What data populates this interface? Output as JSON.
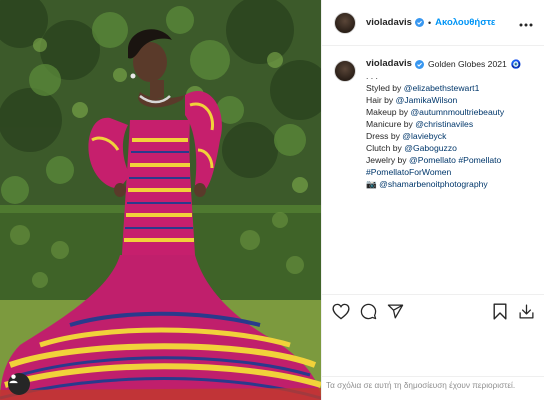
{
  "post": {
    "username": "violadavis",
    "follow_label": "Ακολουθήστε",
    "separator": "•",
    "caption": {
      "title": "Golden Globes 2021",
      "emoji_note": "🧿",
      "dots": ". . .",
      "lines": [
        {
          "prefix": "Styled by ",
          "link": "@elizabethstewart1"
        },
        {
          "prefix": "Hair by ",
          "link": "@JamikaWilson"
        },
        {
          "prefix": "Makeup by ",
          "link": "@autumnmoultriebeauty"
        },
        {
          "prefix": "Manicure by ",
          "link": "@christinaviles"
        },
        {
          "prefix": "Dress by ",
          "link": "@laviebyck"
        },
        {
          "prefix": "Clutch by ",
          "link": "@Gaboguzzo"
        },
        {
          "prefix": "Jewelry by ",
          "link": "@Pomellato",
          "link2": "#Pomellato"
        },
        {
          "prefix": "",
          "link": "#PomellatoForWomen"
        },
        {
          "prefix": "📷 ",
          "link": "@shamarbenoitphotography"
        }
      ]
    },
    "comments_disabled_text": "Τα σχόλια σε αυτή τη δημοσίευση έχουν περιοριστεί."
  },
  "icons": {
    "more": "more-options-icon",
    "like": "heart-icon",
    "comment": "comment-icon",
    "share": "share-icon",
    "save": "bookmark-icon",
    "tags": "user-tag-icon",
    "verified": "verified-badge-icon"
  },
  "colors": {
    "link": "#00376b",
    "follow": "#0095f6",
    "verified": "#3897f0",
    "muted": "#8e8e8e"
  }
}
